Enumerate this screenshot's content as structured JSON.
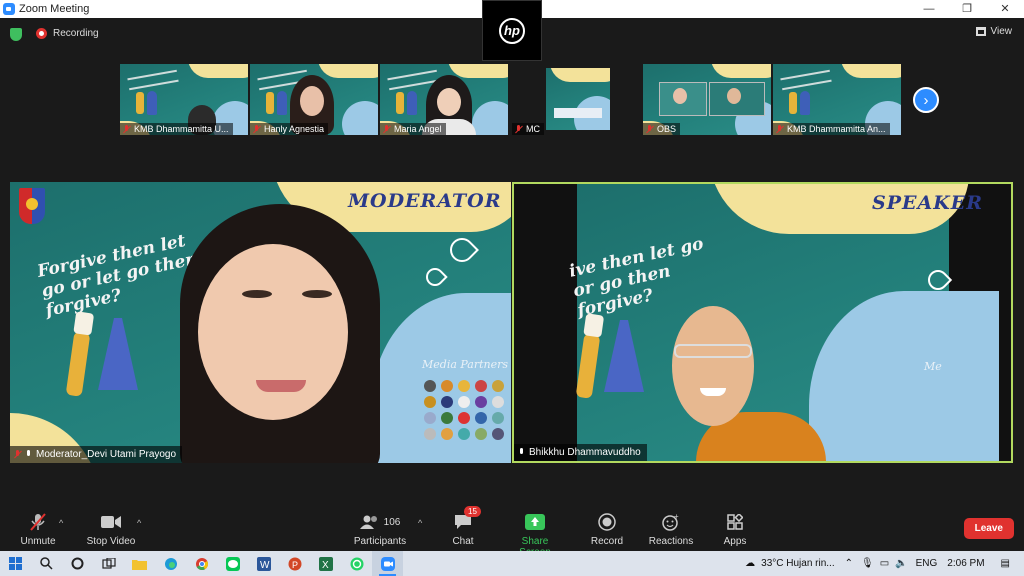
{
  "window": {
    "title": "Zoom Meeting",
    "controls": [
      "—",
      "❐",
      "✕"
    ]
  },
  "camera_logo": "hp",
  "top_bar": {
    "recording": "Recording",
    "view": "View"
  },
  "thumbnails": [
    {
      "name": "KMB Dhammamitta U...",
      "muted": true
    },
    {
      "name": "Hanly Agnestia",
      "muted": true
    },
    {
      "name": "Maria Angel",
      "muted": true
    },
    {
      "name": "MC",
      "muted": true
    },
    {
      "name": "OBS",
      "muted": true
    },
    {
      "name": "KMB Dhammamitta An...",
      "muted": true
    }
  ],
  "main_videos": {
    "moderator": {
      "name": "Moderator_Devi Utami Prayogo",
      "role_title": "MODERATOR",
      "slide_text": "Forgive then let go or let go then forgive?",
      "media_partners": "Media Partners"
    },
    "speaker": {
      "name": "Bhikkhu Dhammavuddho",
      "role_title": "SPEAKER",
      "slide_text": "ive then let go or go then forgive?",
      "media_partners": "Me"
    }
  },
  "toolbar": {
    "unmute": "Unmute",
    "stop_video": "Stop Video",
    "participants": "Participants",
    "participants_count": "106",
    "chat": "Chat",
    "chat_badge": "15",
    "share_screen": "Share Screen",
    "record": "Record",
    "reactions": "Reactions",
    "apps": "Apps",
    "leave": "Leave"
  },
  "taskbar": {
    "weather": "33°C  Hujan rin...",
    "language": "ENG",
    "time": "2:06 PM"
  },
  "colors": {
    "zoom_blue": "#2d8cff",
    "active_speaker_border": "#b2d95f",
    "leave_red": "#e0322f",
    "share_green": "#38c65a",
    "slide_teal": "#23807b",
    "slide_yellow": "#f3e29a"
  }
}
